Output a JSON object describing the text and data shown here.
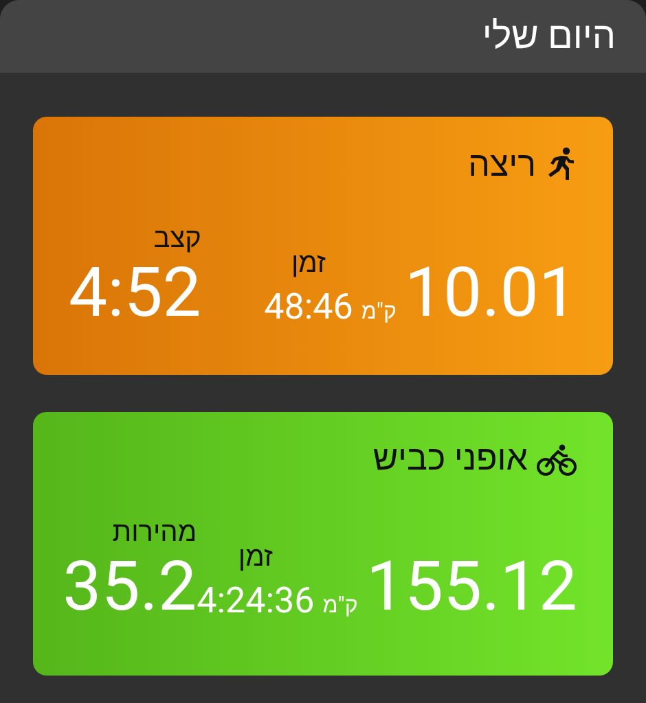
{
  "header": {
    "title": "היום שלי"
  },
  "activities": [
    {
      "kind": "run",
      "title": "ריצה",
      "distance": "10.01",
      "unit": "ק\"מ",
      "time_label": "זמן",
      "time": "48:46",
      "third_label": "קצב",
      "third_value": "4:52"
    },
    {
      "kind": "bike",
      "title": "אופני כביש",
      "distance": "155.12",
      "unit": "ק\"מ",
      "time_label": "זמן",
      "time": "4:24:36",
      "third_label": "מהירות",
      "third_value": "35.2"
    }
  ]
}
